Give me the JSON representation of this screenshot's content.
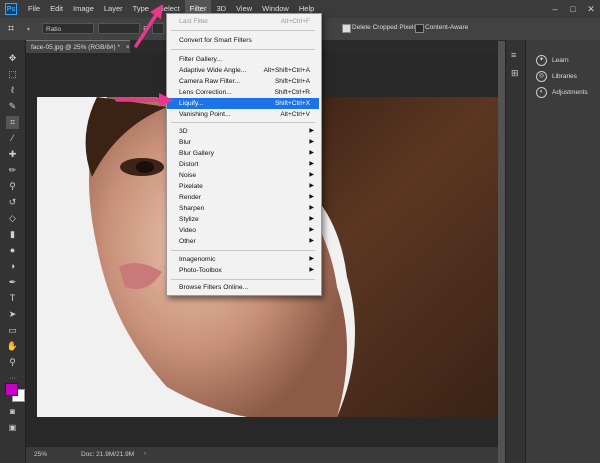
{
  "app_logo": "Ps",
  "menubar": {
    "items": [
      "File",
      "Edit",
      "Image",
      "Layer",
      "Type",
      "Select",
      "Filter",
      "3D",
      "View",
      "Window",
      "Help"
    ],
    "active": "Filter"
  },
  "window_controls": {
    "minimize": "–",
    "restore": "□",
    "close": "✕"
  },
  "options_bar": {
    "ratio_label": "Ratio",
    "delete_cropped": "Delete Cropped Pixels",
    "content_aware": "Content-Aware"
  },
  "document_tab": {
    "title": "face-05.jpg @ 25% (RGB/8#) *",
    "close": "×"
  },
  "status": {
    "zoom": "25%",
    "doc": "Doc: 21.9M/21.9M"
  },
  "right_panel": {
    "items": [
      "Learn",
      "Libraries",
      "Adjustments"
    ]
  },
  "filter_menu": {
    "last_filter": {
      "label": "Last Filter",
      "shortcut": "Alt+Ctrl+F"
    },
    "convert": "Convert for Smart Filters",
    "group1": [
      {
        "label": "Filter Gallery...",
        "shortcut": ""
      },
      {
        "label": "Adaptive Wide Angle...",
        "shortcut": "Alt+Shift+Ctrl+A"
      },
      {
        "label": "Camera Raw Filter...",
        "shortcut": "Shift+Ctrl+A"
      },
      {
        "label": "Lens Correction...",
        "shortcut": "Shift+Ctrl+R"
      },
      {
        "label": "Liquify...",
        "shortcut": "Shift+Ctrl+X"
      },
      {
        "label": "Vanishing Point...",
        "shortcut": "Alt+Ctrl+V"
      }
    ],
    "submenus": [
      "3D",
      "Blur",
      "Blur Gallery",
      "Distort",
      "Noise",
      "Pixelate",
      "Render",
      "Sharpen",
      "Stylize",
      "Video",
      "Other"
    ],
    "plugins": [
      "Imagenomic",
      "Photo-Toolbox"
    ],
    "browse": "Browse Filters Online...",
    "highlighted": "Liquify..."
  },
  "colors": {
    "accent": "#1a73e8",
    "annotation_arrow": "#e8378c",
    "fg_swatch": "#c800c8",
    "bg_swatch": "#ffffff"
  }
}
